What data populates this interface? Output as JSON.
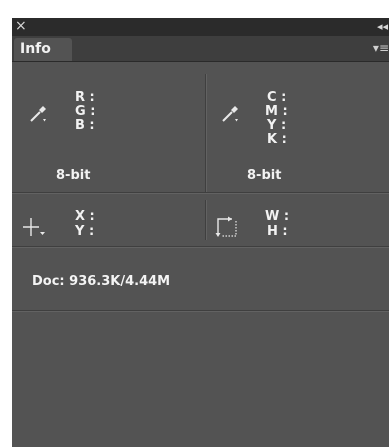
{
  "window": {
    "close_glyph": "×",
    "collapse_glyph": "◂◂",
    "tab_label": "Info",
    "menu_glyph": "▾≡"
  },
  "rgb_section": {
    "icon": "eyedropper-icon",
    "labels": [
      "R :",
      "G :",
      "B :"
    ],
    "bit_depth": "8-bit"
  },
  "cmyk_section": {
    "icon": "eyedropper-icon",
    "labels": [
      "C :",
      "M :",
      "Y :",
      "K :"
    ],
    "bit_depth": "8-bit"
  },
  "position_section": {
    "icon": "crosshair-icon",
    "labels": [
      "X :",
      "Y :"
    ]
  },
  "size_section": {
    "icon": "marquee-size-icon",
    "labels": [
      "W :",
      "H :"
    ]
  },
  "doc_info": "Doc: 936.3K/4.44M",
  "colors": {
    "panel_bg": "#535353",
    "titlebar_bg": "#2b2b2b",
    "tabbar_bg": "#3e3e3e",
    "text": "#f0f0f0"
  }
}
